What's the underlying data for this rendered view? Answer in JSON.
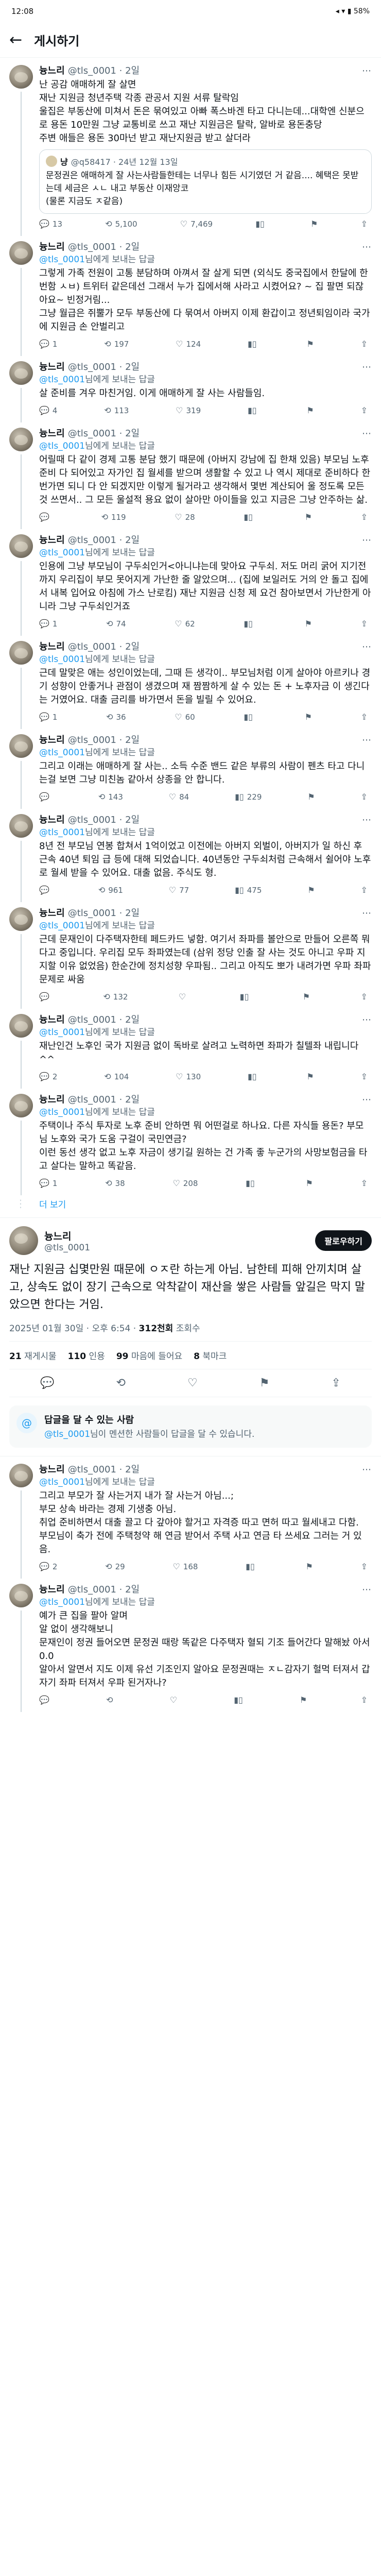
{
  "status_bar": {
    "time": "12:08",
    "icons": "◂ ▾ ▮ 58%"
  },
  "header": {
    "back_icon": "←",
    "title": "게시하기"
  },
  "thread": [
    {
      "name": "늉느리",
      "handle": "@tls_0001 · 2일",
      "replying": "",
      "mention": "",
      "text": "난 공감 애매하게 잘 살면\n재난 지원금 청년주택 각종 관공서 지원 서류 탈락임\n울집은 부동산에 미쳐서 돈은 묶여있고 아빠 폭스바겐 타고 다니는데...대학엔 신분으로 용돈 10만원 그냥 교통비로 쓰고 재난 지원금은 탈락, 알바로 용돈충당\n주변 애들은 용돈 30마넌 받고 재난지원금 받고 살더라",
      "quote": {
        "name": "냥",
        "handle": "@q58417 · 24년 12월 13일",
        "text": "문정권은 애매하게 잘 사는사람들한테는 너무나 힘든 시기였던 거 같음.... 혜택은 못받는데 세금은 ㅅㄴ 내고 부동산 이재앙코\n(물론 지금도 ㅈ같음)"
      },
      "actions": {
        "replies": "13",
        "reposts": "5,100",
        "likes": "7,469",
        "views": ""
      }
    },
    {
      "name": "늉느리",
      "handle": "@tls_0001 · 2일",
      "replying": "님에게 보내는 답글",
      "mention": "@tls_0001",
      "text": "그렇게 가족 전원이 고통 분담하며 아껴서 잘 살게 되면 (외식도 중국집에서 한달에 한번함 ㅅㅂ) 트위터 같은데선 그래서 누가 집에서해 사라고 시켰어요? ~ 집 팔면 되잖아요~ 빈정거림...\n그냥 월급은 쥐뿔가 모두 부동산에 다 묶여서 아버지 이제 환갑이고 정년퇴임이라 국가에 지원금 손 안벌리고",
      "quote": null,
      "actions": {
        "replies": "1",
        "reposts": "197",
        "likes": "124",
        "views": ""
      }
    },
    {
      "name": "늉느리",
      "handle": "@tls_0001 · 2일",
      "replying": "님에게 보내는 답글",
      "mention": "@tls_0001",
      "text": "살 준비를 겨우 마친거임. 이게 애매하게 잘 사는 사람들임.",
      "quote": null,
      "actions": {
        "replies": "4",
        "reposts": "113",
        "likes": "319",
        "views": ""
      }
    },
    {
      "name": "늉느리",
      "handle": "@tls_0001 · 2일",
      "replying": "님에게 보내는 답글",
      "mention": "@tls_0001",
      "text": "어릴때 다 같이 경제 고통 분담 했기 때문에 (아버지 강남에 집 한채 있음) 부모님 노후 준비 다 되어있고 자가인 집 월세를 받으며 생활할 수 있고 나 역시 제대로 준비하다 한번가면 되니 다 안 되겠지만 이렇게 될거라고 생각해서 몇번 계산되어 울 정도록 모든것 쓰면서.. 그 모든 울설적 용요 없이 살아만 아이들을 있고 지금은 그냥 안주하는 삶.",
      "quote": null,
      "actions": {
        "replies": "",
        "reposts": "119",
        "likes": "28",
        "views": ""
      }
    },
    {
      "name": "늉느리",
      "handle": "@tls_0001 · 2일",
      "replying": "님에게 보내는 답글",
      "mention": "@tls_0001",
      "text": "인용에 그냥 부모님이 구두쇠인거<아니냐는데 맞아요 구두쇠. 저도 머리 굵어 지기전까지 우리집이 부모 못어지게 가난한 줄 알았으며... (집에 보일러도 거의 안 돌고 집에서 내복 입어요 아침에 가스 난로킴) 재난 지원금 신청 제 요건 참아보면서 가난한게 아니라 그냥 구두쇠인거죠",
      "quote": null,
      "actions": {
        "replies": "1",
        "reposts": "74",
        "likes": "62",
        "views": ""
      }
    },
    {
      "name": "늉느리",
      "handle": "@tls_0001 · 2일",
      "replying": "님에게 보내는 답글",
      "mention": "@tls_0001",
      "text": "근데 말맞은 애는 성인이었는데, 그때 든 생각이.. 부모님처럼 이게 살아야 아르키나 경기 성향이 안좋거나 관점이 생겼으며 재 짬짬하게 살 수 있는 돈 + 노후자금 이 생긴다는 거였어요. 대출 금리를 바가면서 돈을 빌릴 수 있어요.",
      "quote": null,
      "actions": {
        "replies": "1",
        "reposts": "36",
        "likes": "60",
        "views": ""
      }
    },
    {
      "name": "늉느리",
      "handle": "@tls_0001 · 2일",
      "replying": "님에게 보내는 답글",
      "mention": "@tls_0001",
      "text": "그리고 이래는 애매하게 잘 사는.. 소득 수준 밴드 같은 부류의 사람이 펜츠 타고 다니는걸 보면 그냥 미친놈 같아서 상종을 안 합니다.",
      "quote": null,
      "actions": {
        "replies": "",
        "reposts": "143",
        "likes": "84",
        "views": "229"
      }
    },
    {
      "name": "늉느리",
      "handle": "@tls_0001 · 2일",
      "replying": "님에게 보내는 답글",
      "mention": "@tls_0001",
      "text": "8년 전 부모님 연봉 합쳐서 1억이었고 이전에는 아버지 외벌이, 아버지가 일 하신 후 근속 40년 퇴임 급 등에 대해 되었습니다. 40년동안 구두쇠처럼 근속해서 쉴어야 노후로 월세 받을 수 있어요. 대출 없음. 주식도 형.",
      "quote": null,
      "actions": {
        "replies": "",
        "reposts": "961",
        "likes": "77",
        "views": "475"
      }
    },
    {
      "name": "늉느리",
      "handle": "@tls_0001 · 2일",
      "replying": "님에게 보내는 답글",
      "mention": "@tls_0001",
      "text": "근데 문재인이 다주택자한테 페드카드 넣함. 여기서 좌파를 볼안으로 만들어 오른쪽 뭐 다고 중입니다. 우리집 모두 좌파였는데 (삼위 정당 인출 잘 사는 것도 아니고 우파 지지할 이유 없었음) 한순간에 정치성향 우파됨.. 그리고 아직도 뽀가 내려가면 우파 좌파 문제로 싸움",
      "quote": null,
      "actions": {
        "replies": "",
        "reposts": "132",
        "likes": "",
        "views": ""
      }
    },
    {
      "name": "늉느리",
      "handle": "@tls_0001 · 2일",
      "replying": "님에게 보내는 답글",
      "mention": "@tls_0001",
      "text": "재난인건 노후인 국가 지원금 없이 독바로 살려고 노력하면 좌파가 칠텔좌 내립니다 ^^",
      "quote": null,
      "actions": {
        "replies": "2",
        "reposts": "104",
        "likes": "130",
        "views": ""
      }
    },
    {
      "name": "늉느리",
      "handle": "@tls_0001 · 2일",
      "replying": "님에게 보내는 답글",
      "mention": "@tls_0001",
      "text": "주택이나 주식 투자로 노후 준비 안하면 뭐 어떤걸로 하나요. 다른 자식들 용돈? 부모님 노후와 국가 도움 구걸이 국민연금?\n이런 동선 생각 없고 노후 자금이 생기길 원하는 건 가족 좋 누군가의 사망보험금을 타고 살다는 말하고 똑같음.",
      "quote": null,
      "actions": {
        "replies": "1",
        "reposts": "38",
        "likes": "208",
        "views": ""
      }
    }
  ],
  "show_more": "더 보기",
  "main_post": {
    "name": "늉느리",
    "handle": "@tls_0001",
    "follow_label": "팔로우하기",
    "text": "재난 지원금 십몇만원 때문에 ㅇㅈ란 하는게 아님. 남한테 피해 안끼치며 살고, 상속도 없이 장기 근속으로 악착같이 재산을 쌓은 사람들 앞길은 막지 말았으면 한다는 거임.",
    "date": "2025년 01월 30일 · 오후 6:54",
    "views_count": "312천회",
    "views_label": "조회수",
    "stats": [
      {
        "count": "21",
        "label": "재게시물"
      },
      {
        "count": "110",
        "label": "인용"
      },
      {
        "count": "99",
        "label": "마음에 들어요"
      },
      {
        "count": "8",
        "label": "북마크"
      }
    ],
    "action_icons": [
      "reply-icon",
      "repost-icon",
      "heart-icon",
      "bookmark-icon",
      "share-icon"
    ]
  },
  "notice": {
    "title": "답글을 달 수 있는 사람",
    "mention": "@tls_0001",
    "text": "님이 멘션한 사람들이 답글을 달 수 있습니다."
  },
  "replies_below": [
    {
      "name": "늉느리",
      "handle": "@tls_0001 · 2일",
      "replying": "님에게 보내는 답글",
      "mention": "@tls_0001",
      "text": "그리고 부모가 잘 사는거지 내가 잘 사는거 아님...;\n부모 상속 바라는 경제 기생충 아님.\n취업 준비하면서 대출 끌고 다 갚아야 할거고 자격증 따고 면허 따고 월세내고 다함.\n부모님이 축가 전에 주택청약 해 연금 받어서 주택 사고 연금 타 쓰세요 그러는 거 있음.",
      "actions": {
        "replies": "2",
        "reposts": "29",
        "likes": "168",
        "views": ""
      }
    },
    {
      "name": "늉느리",
      "handle": "@tls_0001 · 2일",
      "replying": "님에게 보내는 답글",
      "mention": "@tls_0001",
      "text": "예가 큰 집을 팔아 알며\n알 없이 생각해보니\n문재인이 정권 들어오면 문정권 때랑 똑같은 다주택자 혈되 기조 들어간다 말해놨 아서 0.0\n알아서 알면서 지도 이제 유선 기조인지 알아요 문정권때는 ㅈㄴ감자기 헐먹 터져서 갑자기 좌파 터져서 우파 된거자나?",
      "actions": {
        "replies": "",
        "reposts": "",
        "likes": "",
        "views": ""
      }
    }
  ]
}
